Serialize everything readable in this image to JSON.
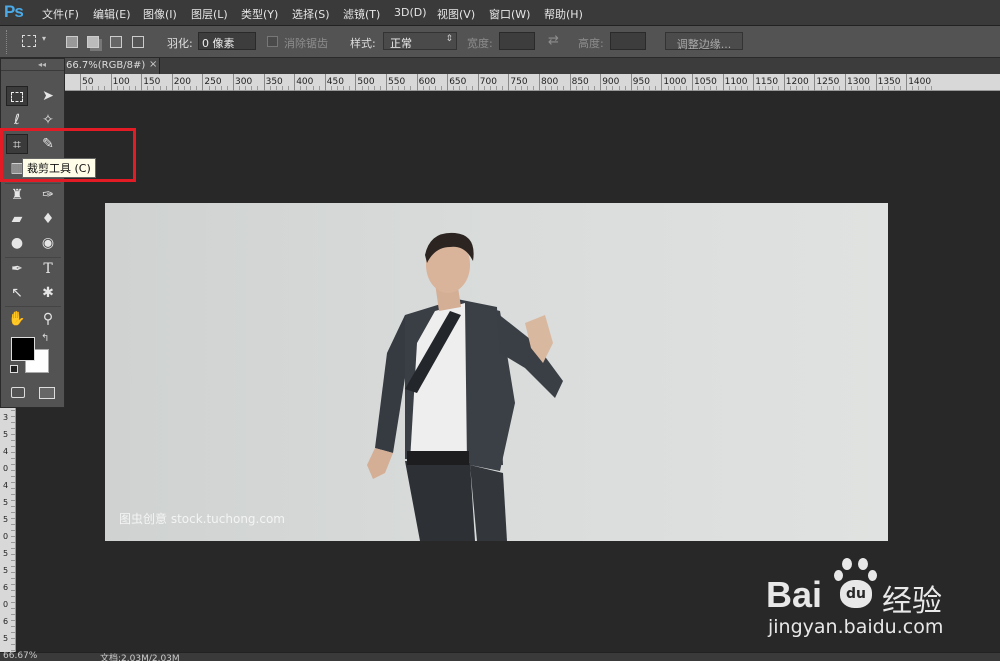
{
  "app": {
    "logo": "Ps"
  },
  "menu": [
    "文件(F)",
    "编辑(E)",
    "图像(I)",
    "图层(L)",
    "类型(Y)",
    "选择(S)",
    "滤镜(T)",
    "3D(D)",
    "视图(V)",
    "窗口(W)",
    "帮助(H)"
  ],
  "options": {
    "feather_label": "羽化:",
    "feather_value": "0 像素",
    "antialias_label": "消除锯齿",
    "style_label": "样式:",
    "style_value": "正常",
    "width_label": "宽度:",
    "height_label": "高度:",
    "refine_edge": "调整边缘..."
  },
  "document": {
    "tab_title": "66.7%(RGB/8#)",
    "tab_close": "×",
    "zoom_status": "66.67%",
    "doc_status": "文档:2.03M/2.03M"
  },
  "ruler": {
    "top": [
      "50",
      "100",
      "150",
      "200",
      "250",
      "300",
      "350",
      "400",
      "450",
      "500",
      "550",
      "600",
      "650",
      "700",
      "750",
      "800",
      "850",
      "900",
      "950",
      "1000",
      "1050",
      "1100",
      "1150",
      "1200",
      "1250",
      "1300",
      "1350",
      "1400"
    ],
    "left": [
      "3",
      "5",
      "4",
      "0",
      "4",
      "5",
      "5",
      "0",
      "5",
      "5",
      "6",
      "0",
      "6",
      "5"
    ]
  },
  "toolbox": {
    "collapse": "◂◂",
    "tools": [
      "marquee",
      "move",
      "lasso",
      "magic-wand",
      "crop",
      "eyedropper",
      "healing",
      "brush",
      "stamp",
      "history-brush",
      "eraser",
      "paint-bucket",
      "blur",
      "dodge",
      "pen",
      "type",
      "path-select",
      "shape",
      "hand",
      "zoom"
    ],
    "type_glyph": "T",
    "tooltip": "裁剪工具 (C)"
  },
  "photo": {
    "watermark": "图虫创意 stock.tuchong.com"
  },
  "branding": {
    "baidu_text": "Bai",
    "baidu_text2": "经验",
    "baidu_url": "jingyan.baidu.com",
    "du": "du"
  },
  "colors": {
    "accent": "#4aa9e6",
    "highlight": "#e21b24",
    "foreground": "#000000",
    "background": "#ffffff"
  }
}
